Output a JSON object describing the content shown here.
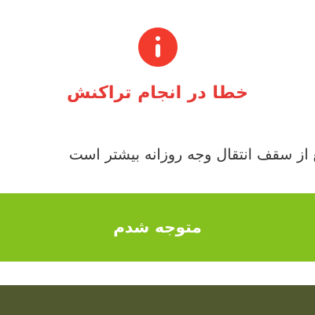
{
  "dialog": {
    "icon": "error-info-icon",
    "title": "خطا در انجام تراکنش",
    "message": "مبلغ از سقف انتقال وجه روزانه بیشتر است",
    "confirm_label": "متوجه شدم"
  },
  "colors": {
    "error": "#f23a2d",
    "title": "#e53935",
    "button": "#85c11e",
    "backdrop": "#4f582e"
  }
}
